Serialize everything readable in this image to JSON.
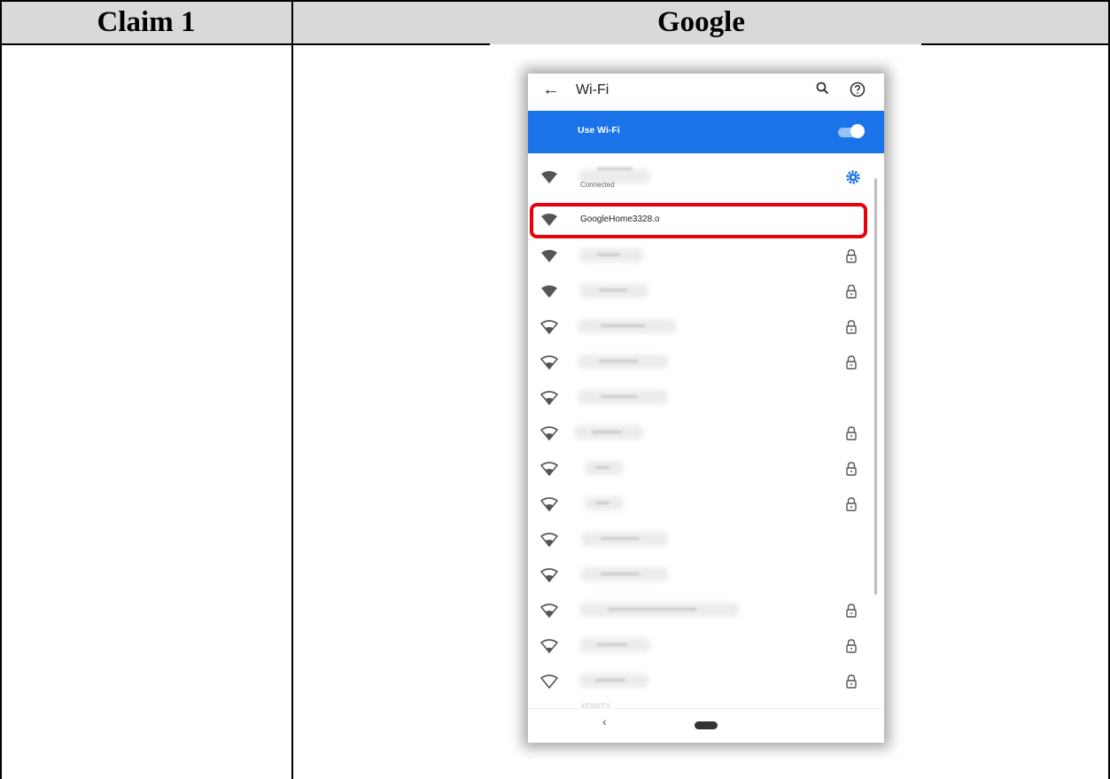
{
  "table": {
    "header_left": "Claim 1",
    "header_right": "Google"
  },
  "phone": {
    "title": "Wi-Fi",
    "use_wifi_label": "Use Wi-Fi",
    "use_wifi_enabled": true,
    "connected_status": "Connected",
    "highlighted_network": "GoogleHome3328.o",
    "partial_bottom_network": "XFINITY",
    "icons": {
      "back": "arrow-left-icon",
      "search": "search-icon",
      "help": "help-circle-icon",
      "settings": "gear-icon",
      "lock": "lock-icon",
      "wifi": "wifi-icon"
    },
    "colors": {
      "accent": "#1a73e8",
      "highlight_box": "#e8000b"
    }
  }
}
